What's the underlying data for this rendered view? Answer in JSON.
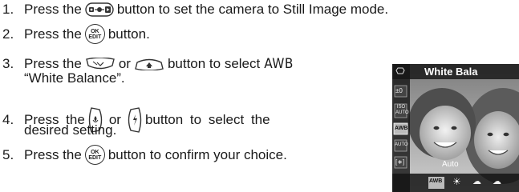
{
  "steps": [
    {
      "num": "1.",
      "pre": "Press the",
      "post": "button to set the camera to Still Image mode.",
      "icon": "mode-button"
    },
    {
      "num": "2.",
      "pre": "Press the",
      "post": "button.",
      "icon": "ok-edit-button"
    },
    {
      "num": "3.",
      "pre": "Press the",
      "mid": "or",
      "post": "button to select",
      "badge": "AWB",
      "cont": "“White Balance”."
    },
    {
      "num": "4.",
      "pre": "Press the",
      "mid": "or",
      "post": "button to select the",
      "cont": "desired setting."
    },
    {
      "num": "5.",
      "pre": "Press the",
      "post": "button to confirm your choice.",
      "icon": "ok-edit-button"
    }
  ],
  "ok_button": {
    "line1": "OK",
    "line2": "EDIT"
  },
  "screen": {
    "title": "White Bala",
    "setting": "Auto",
    "side_icons": [
      "±0",
      "ISO AUTO",
      "AWB",
      "AUTO",
      "[∗]"
    ],
    "bottom_icons": [
      "AWB",
      "☀",
      "☁",
      "☁"
    ]
  }
}
